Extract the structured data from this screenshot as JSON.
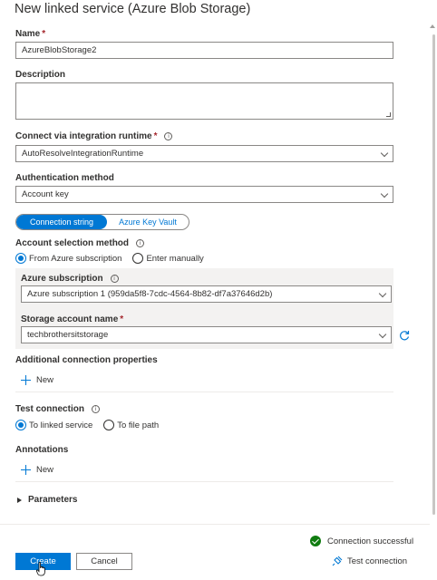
{
  "panel": {
    "title": "New linked service (Azure Blob Storage)"
  },
  "name": {
    "label": "Name",
    "required": "*",
    "value": "AzureBlobStorage2"
  },
  "description": {
    "label": "Description",
    "value": ""
  },
  "integration_runtime": {
    "label": "Connect via integration runtime",
    "required": "*",
    "value": "AutoResolveIntegrationRuntime",
    "info_icon": "info-icon"
  },
  "auth": {
    "label": "Authentication method",
    "value": "Account key"
  },
  "connection_type": {
    "options": [
      "Connection string",
      "Azure Key Vault"
    ],
    "selected": "Connection string"
  },
  "account_selection": {
    "label": "Account selection method",
    "options": [
      "From Azure subscription",
      "Enter manually"
    ],
    "selected": "From Azure subscription"
  },
  "subscription": {
    "label": "Azure subscription",
    "value": "Azure subscription 1 (959da5f8-7cdc-4564-8b82-df7a37646d2b)"
  },
  "storage_account": {
    "label": "Storage account name",
    "required": "*",
    "value": "techbrothersitstorage"
  },
  "additional_props": {
    "label": "Additional connection properties",
    "add_label": "New"
  },
  "test_connection": {
    "label": "Test connection",
    "options": [
      "To linked service",
      "To file path"
    ],
    "selected": "To linked service"
  },
  "annotations": {
    "label": "Annotations",
    "add_label": "New"
  },
  "parameters": {
    "label": "Parameters"
  },
  "footer": {
    "status": "Connection successful",
    "test_connection_label": "Test connection",
    "create_label": "Create",
    "cancel_label": "Cancel"
  },
  "colors": {
    "accent": "#0078d4",
    "success": "#107c10",
    "required": "#a4262c"
  }
}
